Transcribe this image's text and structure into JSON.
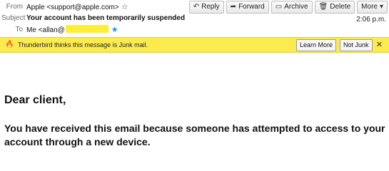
{
  "header": {
    "from_label": "From",
    "from_value": "Apple <support@apple.com>",
    "subject_label": "Subject",
    "subject_value": "Your account has been temporarily suspended",
    "to_label": "To",
    "to_value": "Me <allan@",
    "date": "2:06 p.m."
  },
  "toolbar": {
    "buttons": [
      {
        "label": "Reply",
        "icon": "reply-icon"
      },
      {
        "label": "Forward",
        "icon": "forward-icon"
      },
      {
        "label": "Archive",
        "icon": "archive-icon"
      },
      {
        "label": "Delete",
        "icon": "trash-icon"
      },
      {
        "label": "More",
        "icon": "chevron-down-icon"
      }
    ]
  },
  "junk_bar": {
    "message": "Thunderbird thinks this message is Junk mail.",
    "learn_more": "Learn More",
    "not_junk": "Not Junk",
    "close": "✕",
    "color": "#fbeb4f"
  },
  "message_body": {
    "greeting": "Dear client,",
    "paragraph": "You have received this email because someone has attempted to access to your account through a new device."
  }
}
